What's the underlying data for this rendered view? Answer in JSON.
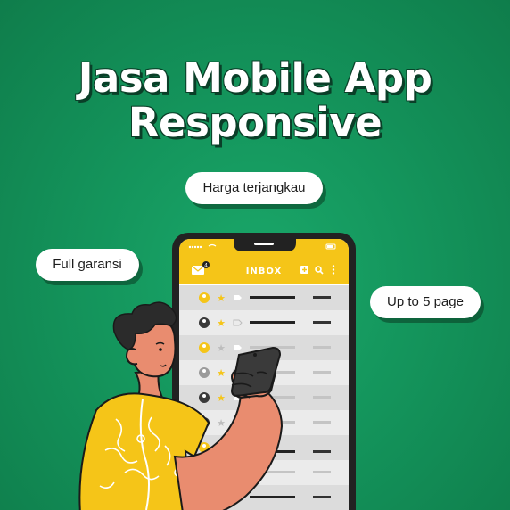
{
  "title": {
    "line1": "Jasa Mobile App",
    "line2": "Responsive"
  },
  "badges": {
    "price": "Harga terjangkau",
    "warranty": "Full garansi",
    "pages": "Up to 5 page"
  },
  "phone": {
    "header_title": "INBOX",
    "mail_badge_count": "4",
    "icons": [
      "mail-icon",
      "plus-icon",
      "search-icon",
      "more-icon",
      "star-icon",
      "tag-icon",
      "avatar-icon"
    ]
  },
  "colors": {
    "background": "#14955c",
    "accent_yellow": "#f5c518",
    "phone_body": "#222222",
    "person_skin": "#e98c6f",
    "person_shirt": "#f5c518"
  }
}
